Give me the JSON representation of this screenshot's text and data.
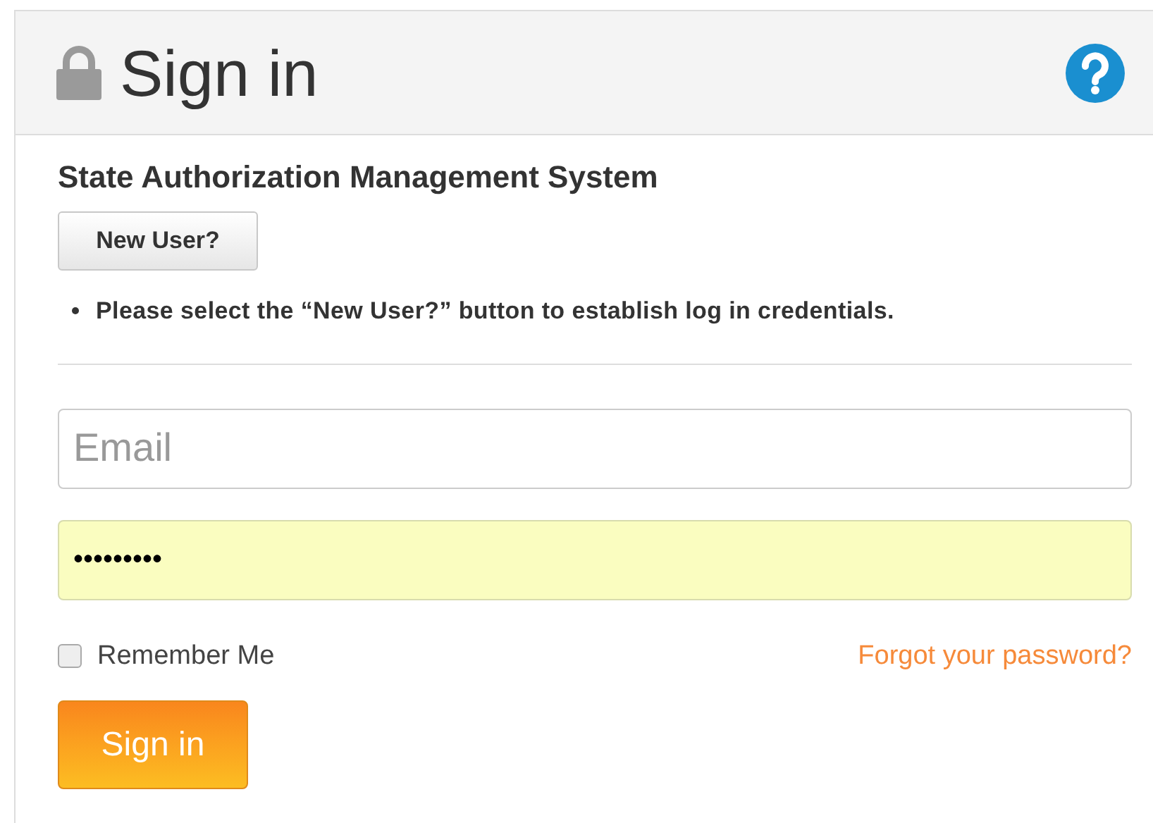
{
  "header": {
    "title": "Sign in"
  },
  "subtitle": "State Authorization Management System",
  "new_user_button": "New User?",
  "notes": [
    "Please select the “New User?” button to establish log in credentials."
  ],
  "email": {
    "placeholder": "Email"
  },
  "password": {
    "value": "•••••••••",
    "autofilled": true
  },
  "remember": {
    "label": "Remember Me",
    "checked": false
  },
  "forgot_link": "Forgot your password?",
  "submit_button": "Sign in"
}
